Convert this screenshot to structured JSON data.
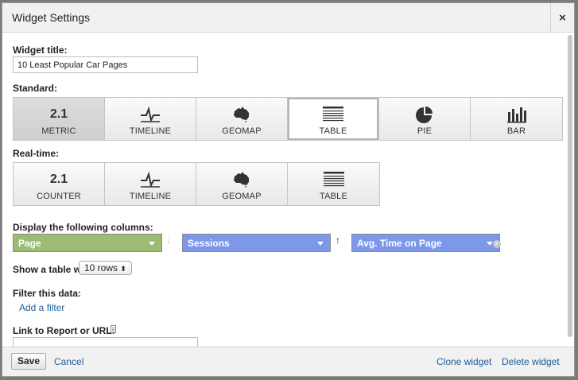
{
  "dialog": {
    "title": "Widget Settings",
    "close_symbol": "×"
  },
  "widget_title": {
    "label": "Widget title:",
    "value": "10 Least Popular Car Pages"
  },
  "standard": {
    "label": "Standard:",
    "tiles": [
      {
        "label": "METRIC",
        "icon": "metric-icon",
        "icon_text": "2.1"
      },
      {
        "label": "TIMELINE",
        "icon": "timeline-icon"
      },
      {
        "label": "GEOMAP",
        "icon": "geomap-icon"
      },
      {
        "label": "TABLE",
        "icon": "table-icon"
      },
      {
        "label": "PIE",
        "icon": "pie-icon"
      },
      {
        "label": "BAR",
        "icon": "bar-icon"
      }
    ]
  },
  "realtime": {
    "label": "Real-time:",
    "tiles": [
      {
        "label": "COUNTER",
        "icon": "counter-icon",
        "icon_text": "2.1"
      },
      {
        "label": "TIMELINE",
        "icon": "timeline-icon"
      },
      {
        "label": "GEOMAP",
        "icon": "geomap-icon"
      },
      {
        "label": "TABLE",
        "icon": "table-icon"
      }
    ]
  },
  "columns": {
    "label": "Display the following columns:",
    "items": [
      {
        "value": "Page",
        "color": "#9cbc73"
      },
      {
        "value": "Sessions",
        "color": "#7d97ea"
      },
      {
        "value": "Avg. Time on Page",
        "color": "#7d97ea"
      }
    ],
    "sort_down_symbol": "↓",
    "sort_up_symbol": "↑",
    "remove_symbol": "×"
  },
  "rows": {
    "label": "Show a table with",
    "value": "10 rows"
  },
  "filter": {
    "label": "Filter this data:",
    "add_link": "Add a filter"
  },
  "link": {
    "label": "Link to Report or URL:",
    "value": ""
  },
  "footer": {
    "save": "Save",
    "cancel": "Cancel",
    "clone": "Clone widget",
    "delete": "Delete widget"
  },
  "colors": {
    "link": "#1f5e96",
    "dimension": "#9cbc73",
    "metric": "#7d97ea"
  }
}
